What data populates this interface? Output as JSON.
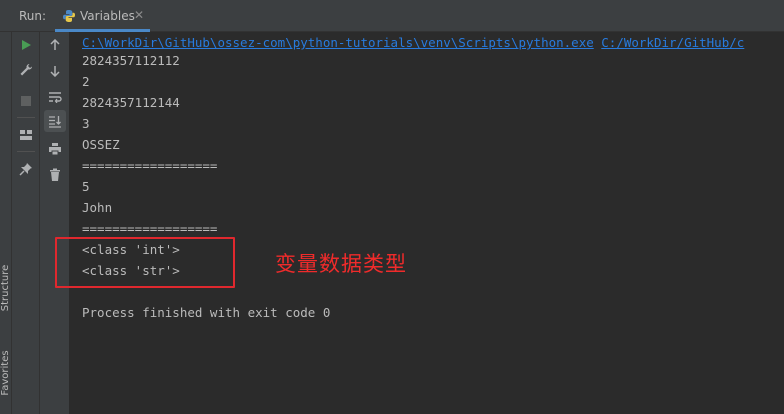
{
  "header": {
    "run_label": "Run:",
    "tab_label": "Variables",
    "tab_close": "✕"
  },
  "stripe": {
    "structure_label": "Structure",
    "favorites_label": "Favorites"
  },
  "toolbar": {
    "buttons": [
      "play-icon",
      "wrench-icon",
      "stop-icon",
      "layout-icon",
      "pin-icon",
      "up-arrow-icon",
      "down-arrow-icon",
      "soft-wrap-icon",
      "scroll-to-end-icon",
      "print-icon",
      "trash-icon"
    ]
  },
  "console": {
    "cmd_path1": "C:\\WorkDir\\GitHub\\ossez-com\\python-tutorials\\venv\\Scripts\\python.exe",
    "cmd_path2": "C:/WorkDir/GitHub/c",
    "lines": [
      "2824357112112",
      "2",
      "2824357112144",
      "3",
      "OSSEZ",
      "==================",
      "5",
      "John",
      "==================",
      "<class 'int'>",
      "<class 'str'>",
      "",
      "Process finished with exit code 0"
    ]
  },
  "annotation": {
    "text": "变量数据类型",
    "color": "#f02b2b"
  },
  "colors": {
    "link": "#287bde",
    "highlight_border": "#e0282e",
    "run_green": "#499c54"
  }
}
